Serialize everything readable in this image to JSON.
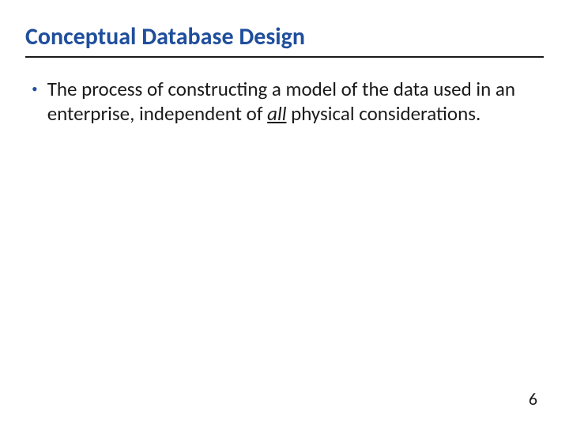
{
  "slide": {
    "title": "Conceptual Database Design",
    "bullets": [
      {
        "text_before": "The process of constructing a model of the data used in an enterprise, independent of ",
        "emphasized": "all",
        "text_after": " physical considerations."
      }
    ],
    "page_number": "6"
  }
}
